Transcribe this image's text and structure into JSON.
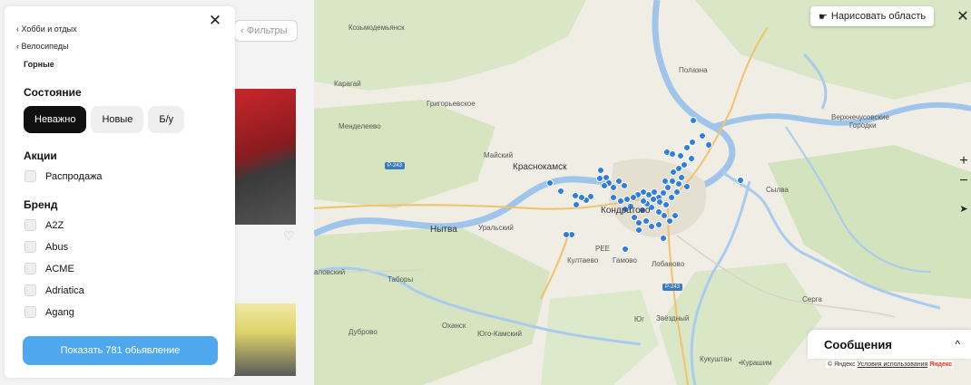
{
  "underlying": {
    "search_placeholder": "‹ Фильтры",
    "heart_icon": "heart-icon"
  },
  "filter_panel": {
    "close_icon": "close-icon",
    "breadcrumbs": [
      "Хобби и отдых",
      "Велосипеды"
    ],
    "current_category": "Горные",
    "condition": {
      "title": "Состояние",
      "options": [
        "Неважно",
        "Новые",
        "Б/у"
      ],
      "selected": "Неважно"
    },
    "promotions": {
      "title": "Акции",
      "options": [
        "Распродажа"
      ]
    },
    "brand": {
      "title": "Бренд",
      "options": [
        "A2Z",
        "Abus",
        "ACME",
        "Adriatica",
        "Agang"
      ]
    },
    "show_button": "Показать 781 обьявление",
    "colors": {
      "accent": "#4fa8ee",
      "chip_active": "#111111"
    }
  },
  "map": {
    "draw_area_button": "Нарисовать область",
    "close_icon": "close-icon",
    "zoom_in": "+",
    "zoom_out": "−",
    "locate_icon": "arrow-location-icon",
    "labels": {
      "kozmodemyansk": "Козьмодемьянск",
      "polazna": "Полазна",
      "karagai": "Карагай",
      "grigorievskoe": "Григорьевское",
      "mendeleevo": "Менделеево",
      "verkhnechusovskie": "Верхнечусовские",
      "gorodki": "Городки",
      "maiskiy": "Майский",
      "krasnokamsk": "Краснокамск",
      "p243a": "Р-243",
      "sylva": "Сылва",
      "kondratovo": "Кондратово",
      "nytva": "Нытва",
      "uralskiy": "Уральский",
      "pee": "PEE",
      "kultaevo": "Култаево",
      "gamovo": "Гамово",
      "lobanovo": "Лобаново",
      "p243b": "Р-243",
      "serga": "Серга",
      "lovskiy": "аловский",
      "taboryi": "Таборы",
      "yug": "Юг",
      "zvezdnyi": "Звёздный",
      "okhansk": "Оханск",
      "yugo_kamskiy": "Юго-Камский",
      "dubrovo": "Дуброво",
      "kukushtan": "Кукуштан",
      "kurashim": "•Курашим"
    },
    "marker_color": "#2f7de1",
    "messages": {
      "title": "Сообщения",
      "chevron": "^"
    },
    "attribution": {
      "brand": "© Яндекс",
      "terms": "Условия использования",
      "logo": "Яндекс"
    }
  }
}
